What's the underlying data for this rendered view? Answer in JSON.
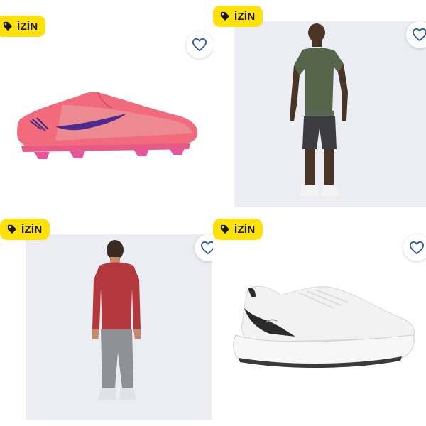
{
  "products": [
    {
      "badge": "İZİN",
      "favorite": false,
      "image": "pink-football-boot",
      "colors": {
        "main": "#f26b7d",
        "swoosh": "#4b2a8f"
      }
    },
    {
      "badge": "İZİN",
      "favorite": false,
      "image": "man-olive-tshirt-shorts",
      "colors": {
        "shirt": "#56644a",
        "shorts": "#3c3c40"
      }
    },
    {
      "badge": "İZİN",
      "favorite": false,
      "image": "man-red-longsleeve-grey-joggers",
      "colors": {
        "shirt": "#b2383e",
        "pants": "#8f9096"
      }
    },
    {
      "badge": "İZİN",
      "favorite": false,
      "image": "white-running-shoe",
      "colors": {
        "upper": "#f2f2f2",
        "heel": "#2a2a2a"
      }
    }
  ],
  "colors": {
    "badge": "#ffe10a",
    "heart": "#2f5aa5"
  }
}
